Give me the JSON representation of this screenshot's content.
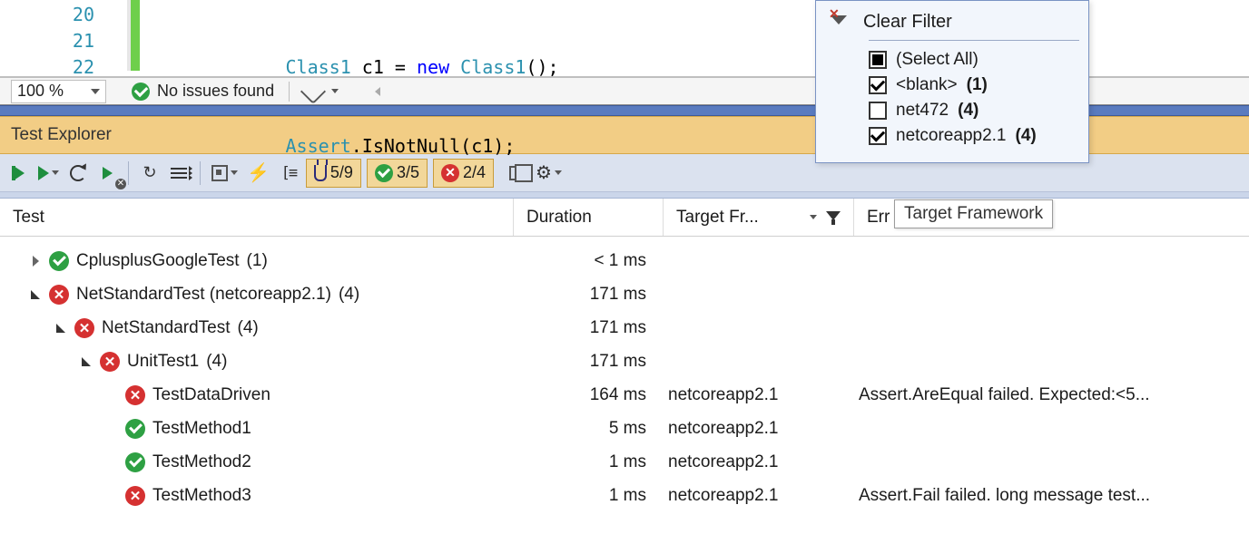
{
  "editor": {
    "line_numbers": [
      "20",
      "21",
      "22"
    ],
    "line1_parts": {
      "indent": "            ",
      "t1": "Class1",
      "v": " c1 = ",
      "kw": "new",
      "sp": " ",
      "t2": "Class1",
      "tail": "();"
    },
    "line2_parts": {
      "indent": "            ",
      "t1": "Assert",
      "dot": ".IsNotNull(c1);"
    }
  },
  "statusbar": {
    "zoom": "100 %",
    "issues": "No issues found"
  },
  "panel_title": "Test Explorer",
  "toolbar": {
    "flask": "5/9",
    "passed": "3/5",
    "failed": "2/4"
  },
  "columns": {
    "test": "Test",
    "duration": "Duration",
    "target": "Target Fr...",
    "error": "Err"
  },
  "tests": [
    {
      "indent": 0,
      "expander": "right",
      "icon": "pass",
      "name": "CplusplusGoogleTest",
      "count": "(1)",
      "duration": "< 1 ms",
      "tf": "",
      "err": ""
    },
    {
      "indent": 0,
      "expander": "down",
      "icon": "fail",
      "name": "NetStandardTest (netcoreapp2.1)",
      "count": "(4)",
      "duration": "171 ms",
      "tf": "",
      "err": ""
    },
    {
      "indent": 1,
      "expander": "down",
      "icon": "fail",
      "name": "NetStandardTest",
      "count": "(4)",
      "duration": "171 ms",
      "tf": "",
      "err": ""
    },
    {
      "indent": 2,
      "expander": "down",
      "icon": "fail",
      "name": "UnitTest1",
      "count": "(4)",
      "duration": "171 ms",
      "tf": "",
      "err": ""
    },
    {
      "indent": 3,
      "expander": "",
      "icon": "fail",
      "name": "TestDataDriven",
      "count": "",
      "duration": "164 ms",
      "tf": "netcoreapp2.1",
      "err": "Assert.AreEqual failed. Expected:<5..."
    },
    {
      "indent": 3,
      "expander": "",
      "icon": "pass",
      "name": "TestMethod1",
      "count": "",
      "duration": "5 ms",
      "tf": "netcoreapp2.1",
      "err": ""
    },
    {
      "indent": 3,
      "expander": "",
      "icon": "pass",
      "name": "TestMethod2",
      "count": "",
      "duration": "1 ms",
      "tf": "netcoreapp2.1",
      "err": ""
    },
    {
      "indent": 3,
      "expander": "",
      "icon": "fail",
      "name": "TestMethod3",
      "count": "",
      "duration": "1 ms",
      "tf": "netcoreapp2.1",
      "err": "Assert.Fail failed. long message test..."
    }
  ],
  "filter": {
    "title": "Clear Filter",
    "items": [
      {
        "check": "blk",
        "label": "(Select All)",
        "count": ""
      },
      {
        "check": "on",
        "label": "<blank>",
        "count": "(1)"
      },
      {
        "check": "",
        "label": "net472",
        "count": "(4)"
      },
      {
        "check": "on",
        "label": "netcoreapp2.1",
        "count": "(4)"
      }
    ]
  },
  "tooltip": "Target Framework"
}
